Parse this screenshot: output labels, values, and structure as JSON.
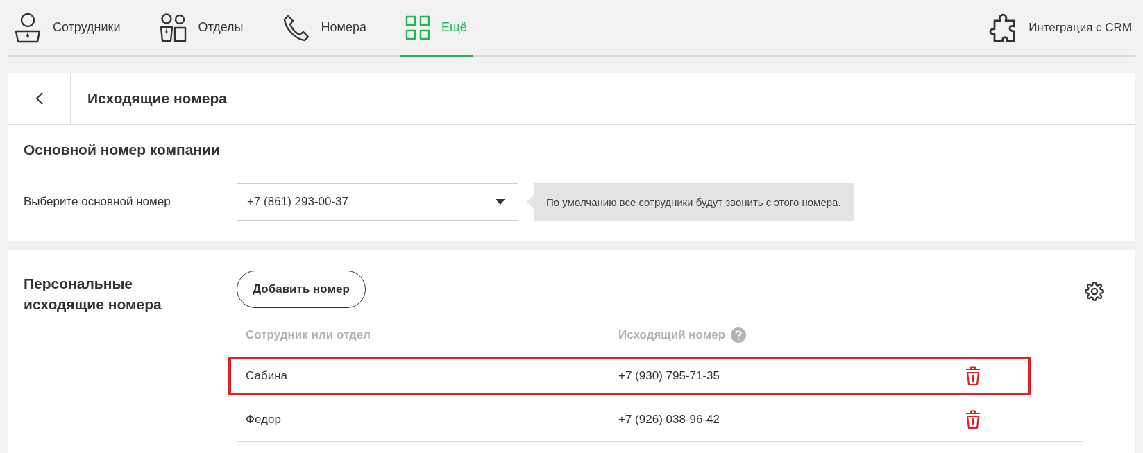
{
  "nav": {
    "tabs": [
      {
        "label": "Сотрудники",
        "kind": "person",
        "selected": false
      },
      {
        "label": "Отделы",
        "kind": "group",
        "selected": false
      },
      {
        "label": "Номера",
        "kind": "phone",
        "selected": false
      },
      {
        "label": "Ещё",
        "kind": "grid",
        "selected": true
      }
    ],
    "integration": {
      "label": "Интеграция с CRM"
    }
  },
  "page": {
    "title": "Исходящие номера"
  },
  "main_number": {
    "heading": "Основной номер компании",
    "label": "Выберите основной номер",
    "value": "+7 (861) 293-00-37",
    "hint": "По умолчанию все сотрудники будут звонить с этого номера."
  },
  "personal": {
    "heading": "Персональные исходящие номера",
    "add_button": "Добавить номер",
    "columns": [
      "Сотрудник или отдел",
      "Исходящий номер"
    ],
    "rows": [
      {
        "name": "Сабина",
        "number": "+7 (930) 795-71-35",
        "highlighted": true
      },
      {
        "name": "Федор",
        "number": "+7 (926) 038-96-42",
        "highlighted": false
      }
    ]
  }
}
